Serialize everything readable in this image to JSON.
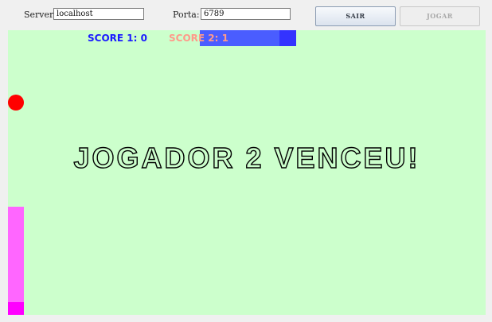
{
  "connection": {
    "server_label": "Server:",
    "server_value": "localhost",
    "port_label": "Porta:",
    "port_value": "6789",
    "exit_button": "SAIR",
    "play_button": "JOGAR"
  },
  "game": {
    "score_1": "SCORE 1: 0",
    "score_2": "SCORE 2: 1",
    "message": "JOGADOR 2 VENCEU!"
  },
  "colors": {
    "court_background": "#ccffcc",
    "top_paddle": "#4a5dff",
    "left_paddle": "#ff66ff",
    "ball": "#ff0000",
    "score_1": "#1a1aff",
    "score_2": "#ff9a8a"
  }
}
